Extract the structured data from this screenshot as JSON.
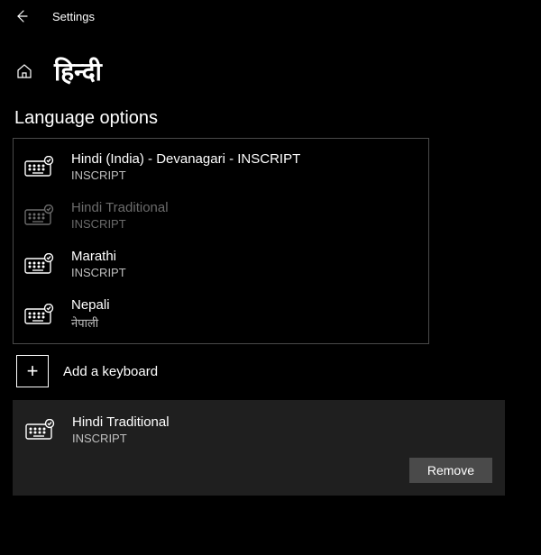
{
  "header": {
    "title": "Settings"
  },
  "page": {
    "title": "हिन्दी"
  },
  "section": {
    "heading": "Language options"
  },
  "keyboards": [
    {
      "name": "Hindi (India) - Devanagari - INSCRIPT",
      "sub": "INSCRIPT",
      "disabled": false
    },
    {
      "name": "Hindi Traditional",
      "sub": "INSCRIPT",
      "disabled": true
    },
    {
      "name": "Marathi",
      "sub": "INSCRIPT",
      "disabled": false
    },
    {
      "name": "Nepali",
      "sub": "नेपाली",
      "disabled": false
    }
  ],
  "add": {
    "label": "Add a keyboard"
  },
  "selected": {
    "name": "Hindi Traditional",
    "sub": "INSCRIPT"
  },
  "buttons": {
    "remove": "Remove"
  }
}
